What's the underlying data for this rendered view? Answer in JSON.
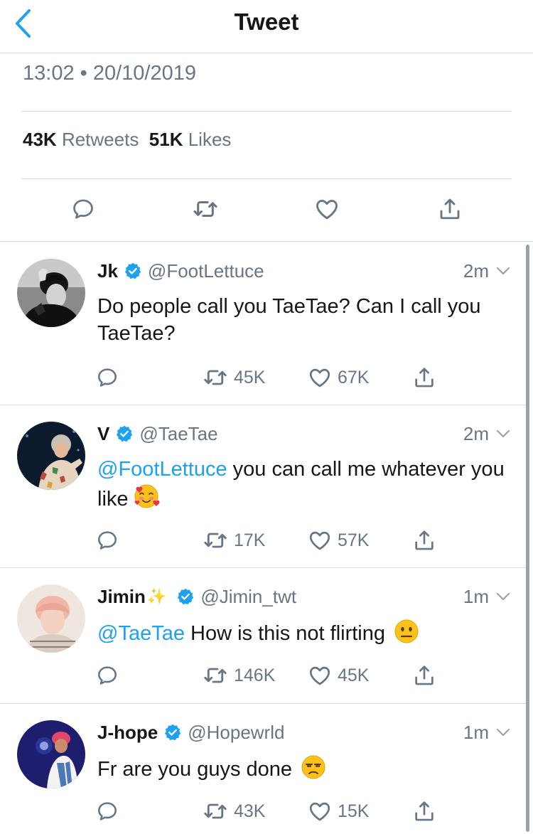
{
  "header": {
    "title": "Tweet",
    "back_icon": "chevron-left-icon"
  },
  "tweet": {
    "timestamp": "13:02 • 20/10/2019",
    "retweets_count": "43K",
    "retweets_label": "Retweets",
    "likes_count": "51K",
    "likes_label": "Likes",
    "actions": [
      "reply-icon",
      "retweet-icon",
      "like-icon",
      "share-icon"
    ]
  },
  "colors": {
    "accent": "#1da1f2",
    "muted": "#657786",
    "text": "#14171a",
    "divider": "#d9dcdf"
  },
  "replies": [
    {
      "name": "Jk",
      "handle": "@FootLettuce",
      "time": "2m",
      "text": "Do people call you TaeTae? Can I call you TaeTae?",
      "retweets": "45K",
      "likes": "67K"
    },
    {
      "name": "V",
      "handle": "@TaeTae",
      "time": "2m",
      "mention": "@FootLettuce",
      "text": " you can call me whatever you like",
      "emoji": "smiling-face-with-hearts",
      "retweets": "17K",
      "likes": "57K"
    },
    {
      "name": "Jimin",
      "name_decoration": "✨",
      "handle": "@Jimin_twt",
      "time": "1m",
      "mention": "@TaeTae",
      "text": " How is this not flirting",
      "emoji": "neutral-face",
      "retweets": "146K",
      "likes": "45K"
    },
    {
      "name": "J-hope",
      "handle": "@Hopewrld",
      "time": "1m",
      "text": "Fr are you guys done",
      "emoji": "unamused-face",
      "retweets": "43K",
      "likes": "15K"
    }
  ]
}
